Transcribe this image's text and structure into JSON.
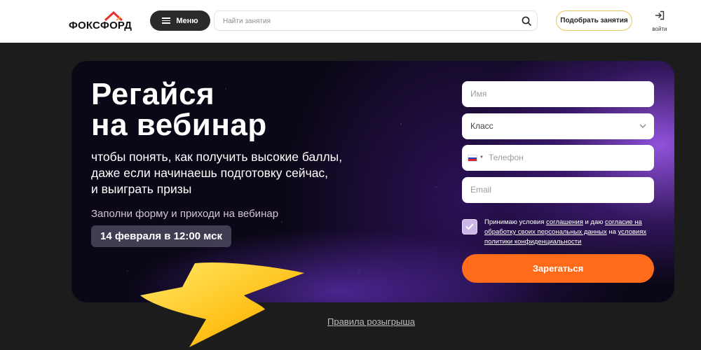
{
  "header": {
    "logo_text": "ФОКСФОРД",
    "menu_label": "Меню",
    "search_placeholder": "Найти занятия",
    "pick_label": "Подобрать занятия",
    "login_label": "войти",
    "icons": [
      "burger-icon",
      "search-icon",
      "login-icon"
    ]
  },
  "banner": {
    "headline_line1": "Регайся",
    "headline_line2": "на вебинар",
    "sub_line1": "чтобы понять, как получить высокие баллы,",
    "sub_line2": "даже если начинаешь подготовку сейчас,",
    "sub_line3": "и выиграть призы",
    "fill_note": "Заполни форму и приходи на вебинар",
    "date": "14 февраля в 12:00 мск"
  },
  "form": {
    "name_placeholder": "Имя",
    "grade_selected": "Класс",
    "phone_placeholder": "Телефон",
    "email_placeholder": "Email",
    "consent_checked": true,
    "consent": {
      "t1": "Принимаю условия ",
      "l1": "соглашения",
      "t2": " и даю ",
      "l2": "согласие на обработку своих персональных данных",
      "t3": " на ",
      "l3": "условиях политики конфиденциальности"
    },
    "submit_label": "Зарегаться"
  },
  "footer": {
    "rules_link": "Правила розыгрыша"
  },
  "colors": {
    "accent_orange": "#ff6b1a",
    "banner_bg": "#0b0716",
    "purple_glow": "#aa5fff",
    "pick_border": "#e8c65a",
    "page_bg": "#1c1c1c"
  }
}
